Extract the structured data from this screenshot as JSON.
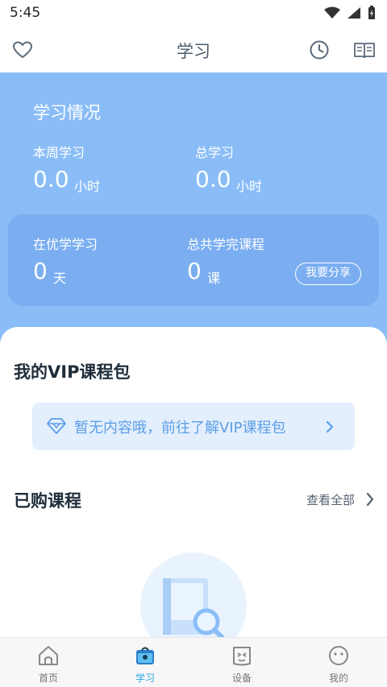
{
  "status_bar": {
    "time": "5:45"
  },
  "header": {
    "title": "学习",
    "icons": [
      "heart-icon",
      "clock-icon",
      "book-icon"
    ]
  },
  "stats": {
    "title": "学习情况",
    "week_label": "本周学习",
    "week_value": "0.0",
    "week_unit": "小时",
    "total_label": "总学习",
    "total_value": "0.0",
    "total_unit": "小时",
    "days_label": "在优学学习",
    "days_value": "0",
    "days_unit": "天",
    "courses_label": "总共学完课程",
    "courses_value": "0",
    "courses_unit": "课",
    "share_label": "我要分享"
  },
  "vip": {
    "title": "我的VIP课程包",
    "banner_text": "暂无内容哦，前往了解VIP课程包"
  },
  "purchased": {
    "title": "已购课程",
    "view_all": "查看全部"
  },
  "bottom_nav": {
    "items": [
      {
        "label": "首页",
        "icon": "home-icon",
        "active": false
      },
      {
        "label": "学习",
        "icon": "study-icon",
        "active": true
      },
      {
        "label": "设备",
        "icon": "device-icon",
        "active": false
      },
      {
        "label": "我的",
        "icon": "profile-icon",
        "active": false
      }
    ]
  },
  "colors": {
    "accent_blue": "#8abdf7",
    "inner_card": "#7aaef0",
    "nav_active": "#2aa6e4",
    "vip_banner": "#e3effd"
  }
}
